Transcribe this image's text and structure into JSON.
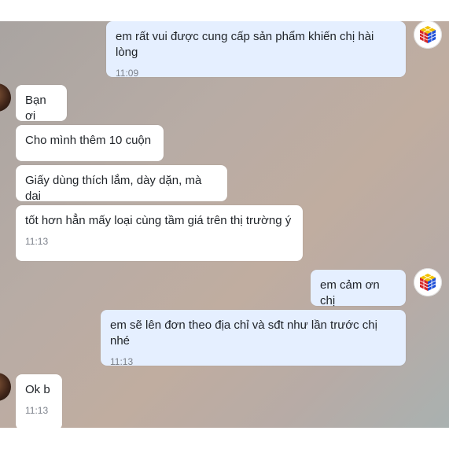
{
  "messages": [
    {
      "id": "m1",
      "side": "sent",
      "text": "em rất vui được cung cấp sản phẩm khiến chị hài lòng",
      "time": "11:09"
    },
    {
      "id": "m2",
      "side": "recv",
      "text": "Bạn ơi"
    },
    {
      "id": "m3",
      "side": "recv",
      "text": "Cho mình thêm 10 cuộn"
    },
    {
      "id": "m4",
      "side": "recv",
      "text": "Giấy dùng thích lắm, dày dặn, mà dai"
    },
    {
      "id": "m5",
      "side": "recv",
      "text": "tốt hơn hẳn mấy loại cùng tầm giá trên thị trường ý",
      "time": "11:13"
    },
    {
      "id": "m6",
      "side": "sent",
      "text": "em cảm ơn chị"
    },
    {
      "id": "m7",
      "side": "sent",
      "text": "em sẽ lên đơn theo địa chỉ và sđt như lần trước chị nhé",
      "time": "11:13"
    },
    {
      "id": "m8",
      "side": "recv",
      "text": "Ok b",
      "time": "11:13"
    }
  ],
  "avatars": {
    "self": "rubiks-cube-avatar",
    "contact": "contact-avatar"
  },
  "colors": {
    "sent_bubble": "#e5efff",
    "received_bubble": "#ffffff",
    "timestamp": "#7b808a"
  }
}
